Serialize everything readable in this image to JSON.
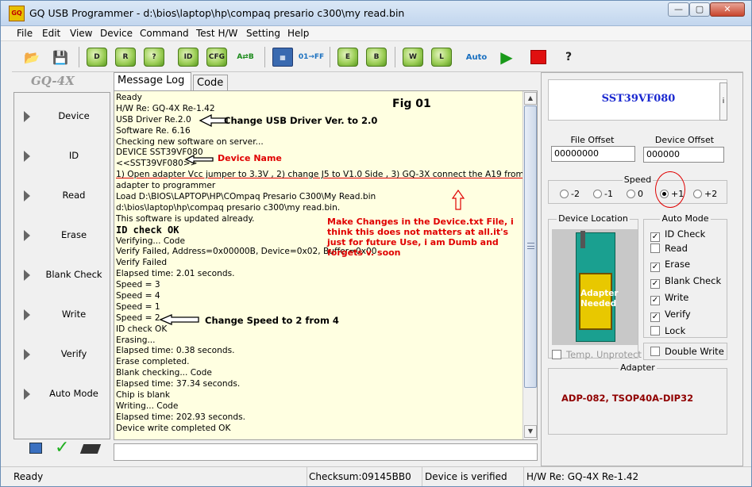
{
  "window": {
    "title": "GQ USB Programmer - d:\\bios\\laptop\\hp\\compaq presario c300\\my read.bin",
    "app_icon_text": "GQ"
  },
  "menu": [
    "File",
    "Edit",
    "View",
    "Device",
    "Command",
    "Test H/W",
    "Setting",
    "Help"
  ],
  "toolbar": {
    "buttons": [
      {
        "name": "open-icon",
        "glyph": "📂"
      },
      {
        "name": "save-icon",
        "glyph": "💾"
      },
      {
        "name": "device-icon",
        "glyph": "D"
      },
      {
        "name": "read-icon",
        "glyph": "R"
      },
      {
        "name": "verify-icon",
        "glyph": "?"
      },
      {
        "name": "id-icon",
        "glyph": "ID"
      },
      {
        "name": "cfg-icon",
        "glyph": "CFG"
      },
      {
        "name": "compare-icon",
        "glyph": "A⇄B"
      },
      {
        "name": "calculator-icon",
        "glyph": "▦"
      },
      {
        "name": "fill-icon",
        "glyph": "01→FF"
      },
      {
        "name": "erase-icon",
        "glyph": "E"
      },
      {
        "name": "blank-check-icon",
        "glyph": "B"
      },
      {
        "name": "write-icon",
        "glyph": "W"
      },
      {
        "name": "lock-icon",
        "glyph": "L"
      },
      {
        "name": "auto-icon",
        "glyph": "Auto"
      },
      {
        "name": "run-icon",
        "glyph": "▶"
      },
      {
        "name": "stop-icon",
        "glyph": ""
      },
      {
        "name": "help-icon",
        "glyph": "?"
      }
    ]
  },
  "logo": "GQ-4X",
  "sidebar": [
    {
      "label": "Device"
    },
    {
      "label": "ID"
    },
    {
      "label": "Read"
    },
    {
      "label": "Erase"
    },
    {
      "label": "Blank Check"
    },
    {
      "label": "Write"
    },
    {
      "label": "Verify"
    },
    {
      "label": "Auto Mode"
    }
  ],
  "tabs": {
    "log": "Message Log",
    "code": "Code"
  },
  "log": [
    "Ready",
    "H/W Re: GQ-4X Re-1.42",
    "USB Driver Re.2.0",
    "Software Re. 6.16",
    "Checking new software on server...",
    "DEVICE SST39VF080",
    "<<SST39VF080>>",
    "1) Open adapter Vcc jumper to 3.3V , 2) change J5 to V1.0 Side , 3) GQ-3X connect the A19 from",
    "adapter to programmer",
    "Load D:\\BIOS\\LAPTOP\\HP\\COmpaq Presario C300\\My Read.bin",
    "d:\\bios\\laptop\\hp\\compaq presario c300\\my read.bin.",
    "This software is updated already.",
    "ID check OK",
    "Verifying... Code",
    "Verify Failed, Address=0x00000B, Device=0x02, Buffer=0x00",
    "Verify Failed",
    "Elapsed time: 2.01 seconds.",
    "Speed = 3",
    "Speed = 4",
    "Speed = 1",
    "Speed = 2",
    "ID check OK",
    "Erasing...",
    "Elapsed time: 0.38 seconds.",
    "Erase completed.",
    "Blank checking... Code",
    "Elapsed time: 37.34 seconds.",
    "Chip is blank",
    "Writing... Code",
    "Elapsed time: 202.93 seconds.",
    "Device write completed OK"
  ],
  "annotations": {
    "fig": "Fig 01",
    "driver": "Change USB Driver Ver. to 2.0",
    "device_name": "Device Name",
    "device_txt": "Make Changes in the Device.txt File, i think this does not matters at all.it's just for future Use, i am Dumb and forgets v. soon",
    "speed": "Change Speed to 2 from 4"
  },
  "right": {
    "chip_name": "SST39VF080",
    "chip_button": "i",
    "file_offset_label": "File Offset",
    "file_offset": "00000000",
    "device_offset_label": "Device Offset",
    "device_offset": "000000",
    "speed_label": "Speed",
    "speed_options": [
      "-2",
      "-1",
      "0",
      "+1",
      "+2"
    ],
    "speed_selected": "+1",
    "device_location_label": "Device Location",
    "adapter_needed": "Adapter Needed",
    "temp_unprotect": "Temp. Unprotect",
    "auto_mode_label": "Auto Mode",
    "auto_mode": [
      {
        "label": "ID Check",
        "checked": true
      },
      {
        "label": "Read",
        "checked": false
      },
      {
        "label": "Erase",
        "checked": true
      },
      {
        "label": "Blank Check",
        "checked": true
      },
      {
        "label": "Write",
        "checked": true
      },
      {
        "label": "Verify",
        "checked": true
      },
      {
        "label": "Lock",
        "checked": false
      }
    ],
    "double_write": "Double Write",
    "adapter_label": "Adapter",
    "adapter_value": "ADP-082, TSOP40A-DIP32"
  },
  "status": {
    "ready": "Ready",
    "checksum": "Checksum:09145BB0",
    "verified": "Device is verified",
    "hw": "H/W Re: GQ-4X Re-1.42"
  }
}
